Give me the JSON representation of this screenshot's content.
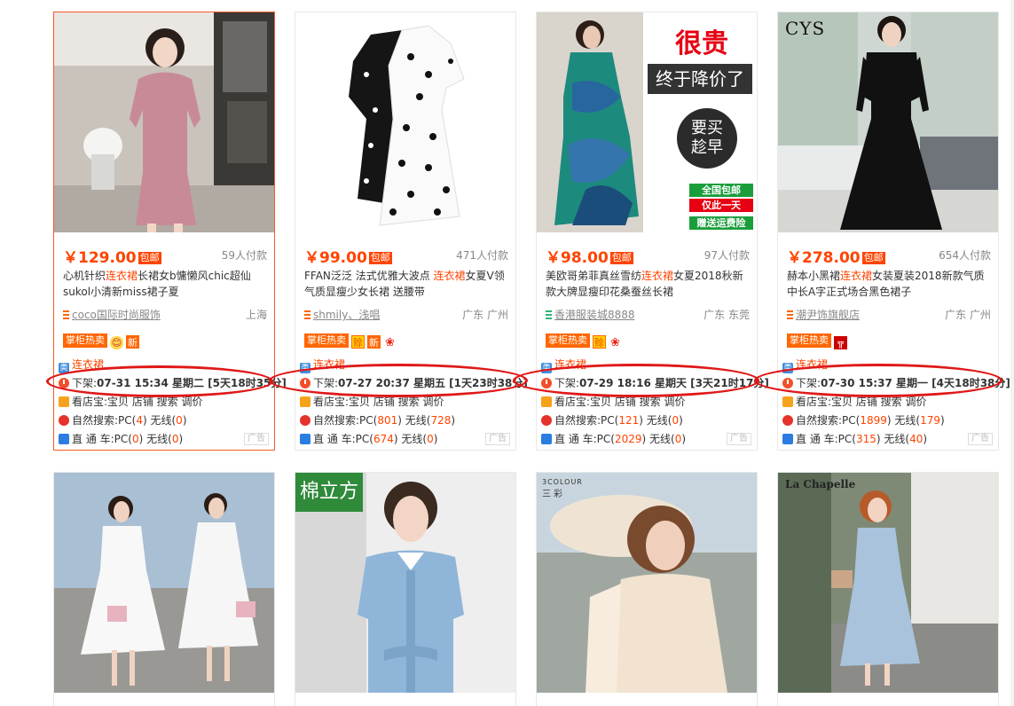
{
  "products": [
    {
      "price": "￥129.00",
      "by_label": "包邮",
      "buyers": "59人付款",
      "title_pre": "心机针织",
      "title_kw": "连衣裙",
      "title_post": "长裙女b慵懒风chic超仙sukol小清新miss裙子夏",
      "shop": "coco国际时尚服饰",
      "location": "上海",
      "tag": "掌柜热卖",
      "tag_icons": [
        "gold",
        "xin"
      ],
      "tag_icon_text": [
        "😊",
        "新"
      ],
      "category_icon": "类",
      "category": "连衣裙",
      "offline_label": "下架:",
      "offline_date": "07-31 15:34 星期二 [5天18时35分]",
      "shop_view": "看店宝:宝贝 店铺 搜索 调价",
      "natural_label": "自然搜索:PC(",
      "natural_pc": "4",
      "natural_mid": ") 无线(",
      "natural_wl": "0",
      "natural_end": ")",
      "direct_label": "直 通 车:PC(",
      "direct_pc": "0",
      "direct_mid": ") 无线(",
      "direct_wl": "0",
      "direct_end": ")",
      "ad": "广告",
      "shop_icon_color": "orange"
    },
    {
      "price": "￥99.00",
      "by_label": "包邮",
      "buyers": "471人付款",
      "title_pre": "FFAN泛泛 法式优雅大波点 ",
      "title_kw": "连衣裙",
      "title_post": "女夏V领气质显瘦少女长裙 送腰带",
      "shop": "shmily、浅唱",
      "location": "广东 广州",
      "tag": "掌柜热卖",
      "tag_icons": [
        "hui",
        "xin",
        "flower"
      ],
      "tag_icon_text": [
        "赊",
        "新",
        "❀"
      ],
      "category_icon": "类",
      "category": "连衣裙",
      "offline_label": "下架:",
      "offline_date": "07-27 20:37 星期五 [1天23时38分]",
      "shop_view": "看店宝:宝贝 店铺 搜索 调价",
      "natural_label": "自然搜索:PC(",
      "natural_pc": "801",
      "natural_mid": ") 无线(",
      "natural_wl": "728",
      "natural_end": ")",
      "direct_label": "直 通 车:PC(",
      "direct_pc": "674",
      "direct_mid": ") 无线(",
      "direct_wl": "0",
      "direct_end": ")",
      "ad": "广告",
      "shop_icon_color": "orange"
    },
    {
      "price": "￥98.00",
      "by_label": "包邮",
      "buyers": "97人付款",
      "title_pre": "美欧哥弟菲真丝雪纺",
      "title_kw": "连衣裙",
      "title_post": "女夏2018秋新款大牌显瘦印花桑蚕丝长裙",
      "shop": "香港服装城8888",
      "location": "广东 东莞",
      "tag": "掌柜热卖",
      "tag_icons": [
        "hui",
        "flower"
      ],
      "tag_icon_text": [
        "赊",
        "❀"
      ],
      "category_icon": "类",
      "category": "连衣裙",
      "offline_label": "下架:",
      "offline_date": "07-29 18:16 星期天 [3天21时17分]",
      "shop_view": "看店宝:宝贝 店铺 搜索 调价",
      "natural_label": "自然搜索:PC(",
      "natural_pc": "121",
      "natural_mid": ") 无线(",
      "natural_wl": "0",
      "natural_end": ")",
      "direct_label": "直 通 车:PC(",
      "direct_pc": "2029",
      "direct_mid": ") 无线(",
      "direct_wl": "0",
      "direct_end": ")",
      "ad": "广告",
      "shop_icon_color": "green",
      "promo": {
        "big": "很贵",
        "line": "终于降价了",
        "bubble1": "要买",
        "bubble2": "趁早",
        "g1": "全国包邮",
        "g2": "仅此一天",
        "g3": "赠送运费险"
      }
    },
    {
      "price": "￥278.00",
      "by_label": "包邮",
      "buyers": "654人付款",
      "title_pre": "赫本小黑裙",
      "title_kw": "连衣裙",
      "title_post": "女装夏装2018新款气质中长A字正式场合黑色裙子",
      "shop": "潮尹饰旗舰店",
      "location": "广东 广州",
      "tag": "掌柜热卖",
      "tag_icons": [
        "red"
      ],
      "tag_icon_text": [
        "╦"
      ],
      "category_icon": "类",
      "category": "连衣裙",
      "offline_label": "下架:",
      "offline_date": "07-30 15:37 星期一 [4天18时38分]",
      "shop_view": "看店宝:宝贝 店铺 搜索 调价",
      "natural_label": "自然搜索:PC(",
      "natural_pc": "1899",
      "natural_mid": ") 无线(",
      "natural_wl": "179",
      "natural_end": ")",
      "direct_label": "直 通 车:PC(",
      "direct_pc": "315",
      "direct_mid": ") 无线(",
      "direct_wl": "40",
      "direct_end": ")",
      "ad": "广告",
      "shop_icon_color": "orange",
      "brand": "CYS"
    }
  ],
  "second_row": {
    "badge2": "棉立方",
    "brand3a": "3COLOUR",
    "brand3b": "三 彩",
    "brand4": "La Chapelle"
  },
  "colors": {
    "accent": "#ff4400",
    "circle": "#e01818",
    "tag": "#ff6600"
  }
}
